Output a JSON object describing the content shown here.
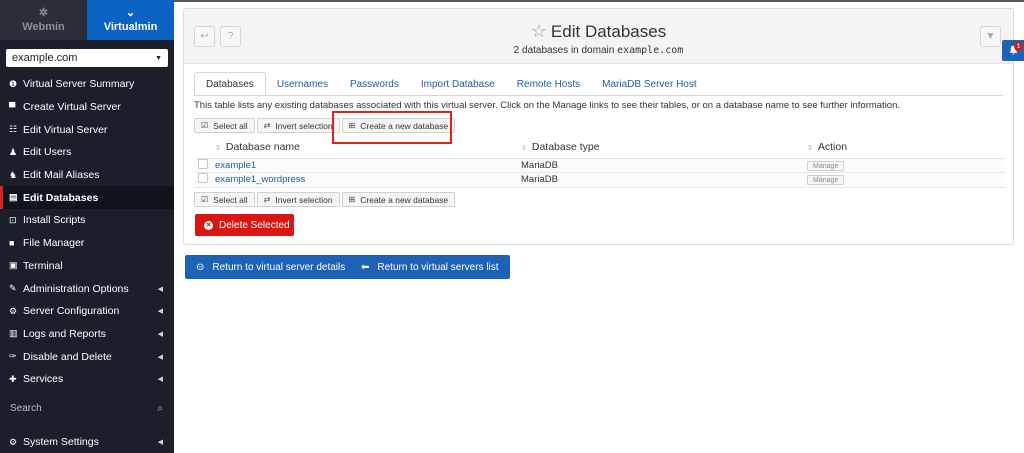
{
  "sidebar": {
    "tab_webmin": "Webmin",
    "tab_virtualmin": "Virtualmin",
    "domain": "example.com",
    "items": [
      {
        "label": "Virtual Server Summary",
        "icon": "info-circle-icon",
        "glyph": "❶",
        "submenu": false,
        "active": false
      },
      {
        "label": "Create Virtual Server",
        "icon": "server-plus-icon",
        "glyph": "▀",
        "submenu": false,
        "active": false
      },
      {
        "label": "Edit Virtual Server",
        "icon": "sliders-icon",
        "glyph": "☷",
        "submenu": false,
        "active": false
      },
      {
        "label": "Edit Users",
        "icon": "users-icon",
        "glyph": "♟",
        "submenu": false,
        "active": false
      },
      {
        "label": "Edit Mail Aliases",
        "icon": "mail-alias-icon",
        "glyph": "♞",
        "submenu": false,
        "active": false
      },
      {
        "label": "Edit Databases",
        "icon": "database-icon",
        "glyph": "▤",
        "submenu": false,
        "active": true
      },
      {
        "label": "Install Scripts",
        "icon": "install-icon",
        "glyph": "⊡",
        "submenu": false,
        "active": false
      },
      {
        "label": "File Manager",
        "icon": "folder-icon",
        "glyph": "■",
        "submenu": false,
        "active": false
      },
      {
        "label": "Terminal",
        "icon": "terminal-icon",
        "glyph": "▣",
        "submenu": false,
        "active": false
      },
      {
        "label": "Administration Options",
        "icon": "wrench-icon",
        "glyph": "✎",
        "submenu": true,
        "active": false
      },
      {
        "label": "Server Configuration",
        "icon": "cogs-icon",
        "glyph": "⚙",
        "submenu": true,
        "active": false
      },
      {
        "label": "Logs and Reports",
        "icon": "file-chart-icon",
        "glyph": "▥",
        "submenu": true,
        "active": false
      },
      {
        "label": "Disable and Delete",
        "icon": "plug-icon",
        "glyph": "✑",
        "submenu": true,
        "active": false
      },
      {
        "label": "Services",
        "icon": "cubes-icon",
        "glyph": "✚",
        "submenu": true,
        "active": false
      }
    ],
    "search_placeholder": "Search",
    "system_settings": "System Settings"
  },
  "header": {
    "title": "Edit Databases",
    "subtitle_prefix": "2 databases in domain ",
    "subtitle_domain": "example.com"
  },
  "tabs": [
    "Databases",
    "Usernames",
    "Passwords",
    "Import Database",
    "Remote Hosts",
    "MariaDB Server Host"
  ],
  "description": "This table lists any existing databases associated with this virtual server. Click on the Manage links to see their tables, or on a database name to see further information.",
  "buttons": {
    "select_all": "Select all",
    "invert_selection": "Invert selection",
    "create_new": "Create a new database",
    "delete_selected": "Delete Selected",
    "return_server": "Return to virtual server details",
    "return_list": "Return to virtual servers list"
  },
  "table": {
    "columns": [
      "Database name",
      "Database type",
      "Action"
    ],
    "rows": [
      {
        "name": "example1",
        "type": "MariaDB",
        "action": "Manage"
      },
      {
        "name": "example1_wordpress",
        "type": "MariaDB",
        "action": "Manage"
      }
    ]
  },
  "notifications": {
    "count": "1"
  },
  "colors": {
    "sidebar_bg": "#1b1f2b",
    "accent_blue": "#1c63b8",
    "danger_red": "#d9160f",
    "active_marker": "#d9231d",
    "link": "#1a5ea8"
  }
}
